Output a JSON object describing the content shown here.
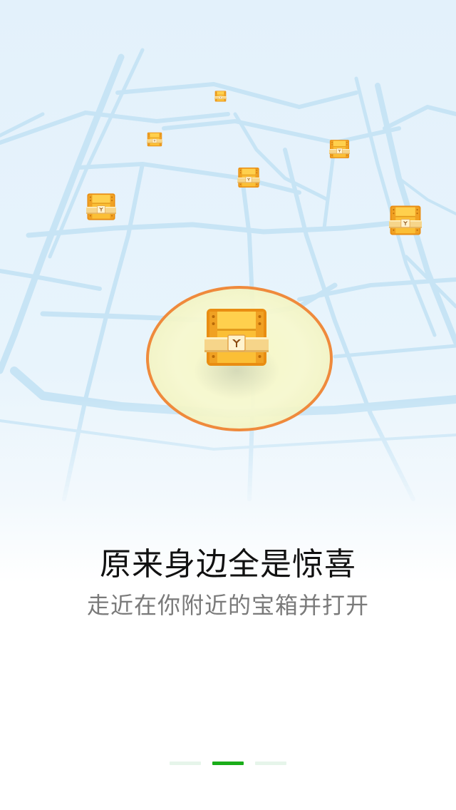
{
  "intro": {
    "title": "原来身边全是惊喜",
    "subtitle": "走近在你附近的宝箱并打开"
  },
  "pager": {
    "page_count": 3,
    "active_index": 1,
    "active_color": "#1aad19",
    "inactive_color": "#e6f5ea"
  },
  "illustration": {
    "road_color": "#c7e4f5",
    "highlight_ring_color": "#ef8a3c",
    "chest_color": "#f7b12a",
    "icon": "treasure-chest-icon"
  }
}
